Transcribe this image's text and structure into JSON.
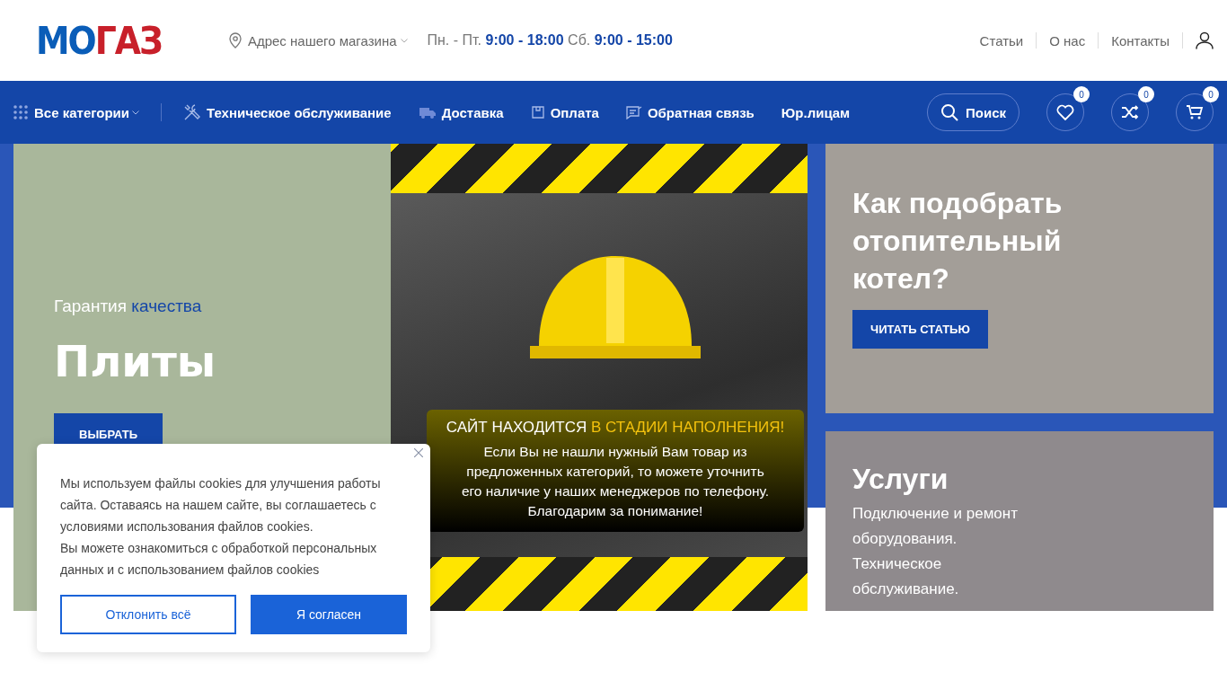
{
  "header": {
    "logo": [
      {
        "text": "МО",
        "color": "#0a5db8"
      },
      {
        "text": "ГАЗ",
        "color": "#c8202a"
      }
    ],
    "address": "Адрес нашего магазина",
    "schedule": "Пн. - Пт. **9:00 - 18:00** Сб. **9:00 - 15:00**",
    "links": [
      "Статьи",
      "О нас",
      "Контакты"
    ]
  },
  "nav": {
    "categories": "Все категории",
    "items": [
      {
        "label": "Техническое обслуживание",
        "kind": "tools"
      },
      {
        "label": "Доставка",
        "kind": "truck"
      },
      {
        "label": "Оплата",
        "kind": "box"
      },
      {
        "label": "Обратная связь",
        "kind": "feedback"
      },
      {
        "label": "Юр.лицам",
        "kind": "plain"
      }
    ],
    "search": "Поиск",
    "actions": [
      {
        "kind": "heart",
        "count": "0"
      },
      {
        "kind": "shuffle",
        "count": "0"
      },
      {
        "kind": "cart",
        "count": "0"
      }
    ]
  },
  "hero": {
    "tagline_lead": "Гарантия",
    "tagline_accent": "качества",
    "title": "Плиты",
    "button": "ВЫБРАТЬ",
    "notice": {
      "heading_lead": "САЙТ НАХОДИТСЯ",
      "heading_accent": "В СТАДИИ НАПОЛНЕНИЯ!",
      "text": "Если Вы не нашли нужный Вам товар из предложенных категорий, то можете уточнить его наличие у наших менеджеров по телефону. Благодарим за понимание!"
    },
    "cards": [
      {
        "kind": "article",
        "title": "Как подобрать отопительный котел?",
        "button": "ЧИТАТЬ СТАТЬЮ"
      },
      {
        "kind": "service",
        "title": "Услуги",
        "text": "Подключение и ремонт оборудования. Техническое обслуживание."
      }
    ]
  },
  "cookie": {
    "paragraphs": [
      "Мы используем файлы cookies для улучшения работы сайта. Оставаясь на нашем сайте, вы соглашаетесь с условиями использования файлов cookies.",
      "Вы можете ознакомиться с обработкой персональных данных и с использованием файлов cookies"
    ],
    "decline": "Отклонить всё",
    "accept": "Я согласен"
  }
}
